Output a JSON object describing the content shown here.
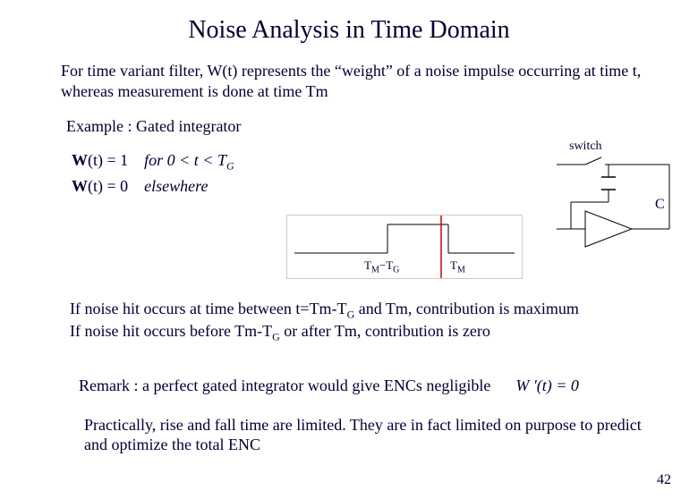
{
  "title": "Noise Analysis in Time Domain",
  "intro": "For time variant filter, W(t) represents the “weight” of a noise impulse occurring at time t, whereas measurement is done at time Tm",
  "example_label": "Example : Gated integrator",
  "eq_line1_prefix": "W",
  "eq_line1_arg": "(t) = 1",
  "eq_line1_cond_prefix": "for ",
  "eq_line1_cond": "0 < t < T",
  "eq_line1_cond_sub": "G",
  "eq_line2_prefix": "W",
  "eq_line2_arg": "(t) = 0",
  "eq_line2_cond": "elsewhere",
  "switch_label": "switch",
  "c_label": "C",
  "wave_left_T": "T",
  "wave_left_sub": "M",
  "wave_minus": "−",
  "wave_left_T2": "T",
  "wave_left_sub2": "G",
  "wave_right_T": "T",
  "wave_right_sub": "M",
  "cond1": "If noise hit occurs at time between  t=Tm-T",
  "cond1_sub": "G",
  "cond1_rest": " and Tm, contribution is maximum",
  "cond2": "If noise hit occurs before Tm-T",
  "cond2_sub": "G",
  "cond2_rest": " or after Tm, contribution is zero",
  "remark": "Remark : a perfect gated integrator would give ENCs negligible",
  "wprime": "W '(t) = 0",
  "practically": "Practically, rise and fall time are limited. They are in fact limited on purpose to predict and optimize the total ENC",
  "page_number": "42"
}
